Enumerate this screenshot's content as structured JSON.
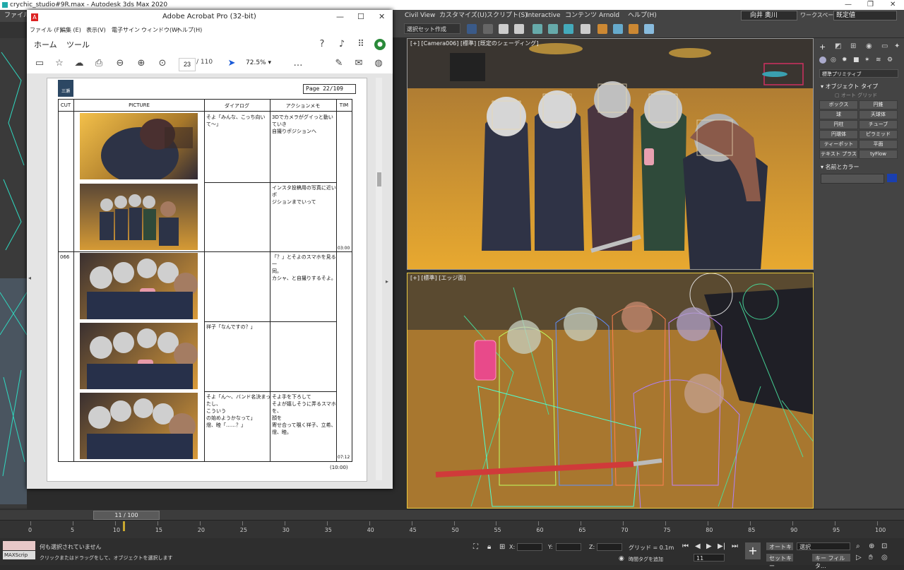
{
  "max": {
    "title": "crychic_studio#9R.max - Autodesk 3ds Max 2020",
    "file_menu": "ファイル(F",
    "menu": [
      "Civil View",
      "カスタマイズ(U)",
      "スクリプト(S)",
      "Interactive",
      "コンテンツ",
      "Arnold",
      "ヘルプ(H)"
    ],
    "user": "向井 奥川",
    "workspace_label": "ワークスペース:",
    "workspace_value": "既定値",
    "selection_set": "選択セット作成"
  },
  "acrobat": {
    "title": "Adobe Acrobat Pro (32-bit)",
    "menu": [
      "ファイル (F)",
      "編集 (E)",
      "表示(V)",
      "電子サイン",
      "ウィンドウ(W)",
      "ヘルプ(H)"
    ],
    "tabs": {
      "home": "ホーム",
      "tools": "ツール"
    },
    "page_current": "23",
    "page_total": "/ 110",
    "zoom": "72.5%"
  },
  "storyboard": {
    "logo_text": "三瀬",
    "page_label": "Page  22/109",
    "headers": {
      "cut": "CUT",
      "picture": "PICTURE",
      "dialog": "ダイアログ",
      "action": "アクションメモ",
      "time": "TIM"
    },
    "rows": [
      {
        "cut": "",
        "dialog": "そよ「みんな、こっち向いて～」",
        "action": "3Dでカメラがグイっと動いていき\n自撮りポジションへ",
        "time": ""
      },
      {
        "cut": "",
        "dialog": "",
        "action": "インスタ投稿用の写真に近いポ\nジションまでいって",
        "time": "03:00"
      },
      {
        "cut": "066",
        "dialog": "",
        "action": "「？」とそよのスマホを見る一\n同。\nカシャ、と自撮りするそよ。",
        "time": ""
      },
      {
        "cut": "",
        "dialog": "祥子「なんですの？」",
        "action": "",
        "time": ""
      },
      {
        "cut": "",
        "dialog": "そよ「ん～、バンド名決まったし、\nこういう\nの始めようかなって」\n燈、睦「……？」",
        "action": "そよ手を下ろして\nそよが嬉しそうに弄るスマホを、\n顔を\n寄せ合って覗く祥子、立希、\n燈、睦。",
        "time": "07:12"
      }
    ],
    "total_time": "(10:00)"
  },
  "viewports": {
    "top_label": "[+] [Camera006] [標準] [既定のシェーディング]",
    "bottom_label": "[+] [標準] [エッジ面]"
  },
  "command_panel": {
    "dropdown": "標準プリミティブ",
    "object_type_head": "オブジェクト タイプ",
    "auto_grid": "オート グリッド",
    "buttons": [
      "ボックス",
      "円錐",
      "球",
      "天球体",
      "円柱",
      "チューブ",
      "円環体",
      "ピラミッド",
      "ティーポット",
      "平面",
      "テキスト プラス",
      "tyFlow"
    ],
    "name_color_head": "名前とカラー",
    "swatch_color": "#1a3fb0"
  },
  "timeline": {
    "slider_label": "11 / 100",
    "ticks": [
      "0",
      "5",
      "10",
      "15",
      "20",
      "25",
      "30",
      "35",
      "40",
      "45",
      "50",
      "55",
      "60",
      "65",
      "70",
      "75",
      "80",
      "85",
      "90",
      "95",
      "100"
    ]
  },
  "status": {
    "maxscript": "MAXScrip",
    "line1": "何も選択されていません",
    "line2": "クリックまたはドラッグをして、オブジェクトを選択します",
    "x_label": "X:",
    "y_label": "Y:",
    "z_label": "Z:",
    "grid": "グリッド = 0.1m",
    "time_tag": "時間タグを追加",
    "frame": "11",
    "auto_key": "オートキー",
    "selection": "選択",
    "set_key": "セットキー",
    "key_filter": "キー フィルタ..."
  }
}
